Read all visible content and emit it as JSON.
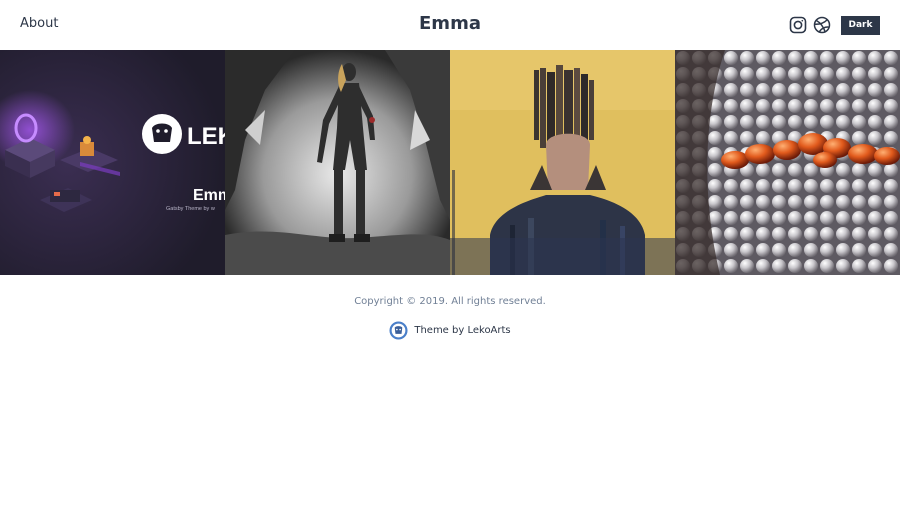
{
  "header": {
    "about_label": "About",
    "site_title": "Emma",
    "mode_button_label": "Dark"
  },
  "socials": [
    "instagram-icon",
    "dribbble-icon"
  ],
  "projects": [
    {
      "name": "project-tile-lekoarts-emma",
      "overlay_title": "Emm",
      "overlay_logo_text": "LEK",
      "overlay_sub": "Gatsby Theme by w"
    },
    {
      "name": "project-tile-warrior-woman"
    },
    {
      "name": "project-tile-glitch-portrait"
    },
    {
      "name": "project-tile-spheres"
    }
  ],
  "footer": {
    "copyright": "Copyright © 2019. All rights reserved.",
    "credit_label": "Theme by LekoArts"
  },
  "colors": {
    "primary": "#2d3748",
    "muted": "#718096",
    "background": "#ffffff"
  }
}
